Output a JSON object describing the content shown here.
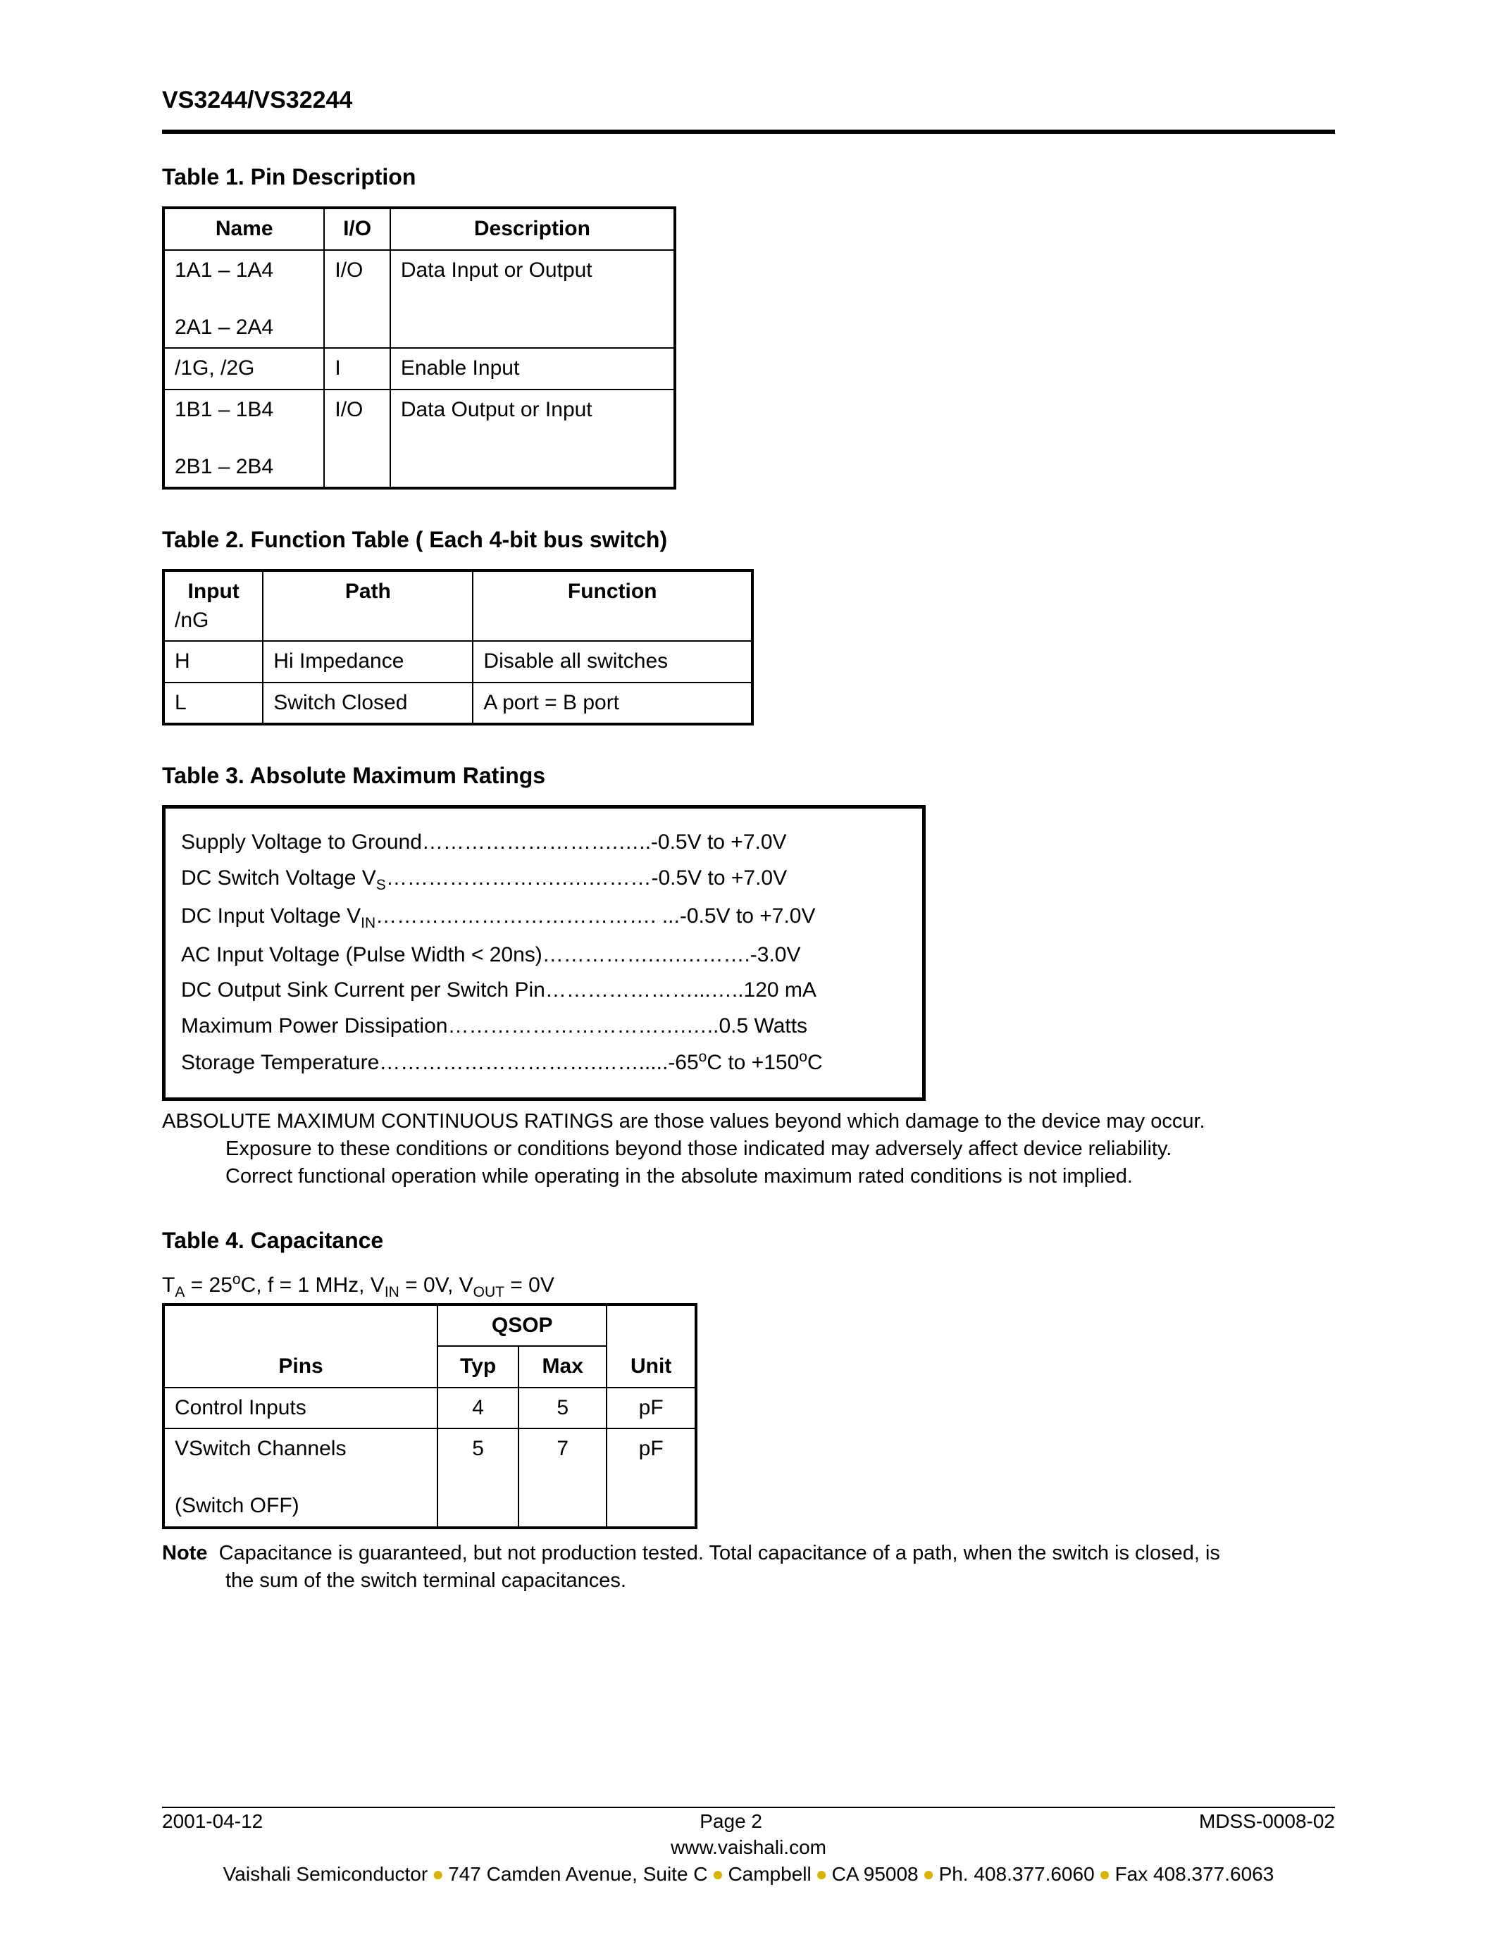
{
  "header": {
    "title": "VS3244/VS32244"
  },
  "table1": {
    "title": "Table 1.  Pin Description",
    "headers": [
      "Name",
      "I/O",
      "Description"
    ],
    "rows": [
      {
        "name_l1": "1A1 – 1A4",
        "name_l2": "2A1 – 2A4",
        "io": "I/O",
        "desc": "Data Input or Output"
      },
      {
        "name_l1": "/1G, /2G",
        "name_l2": "",
        "io": "I",
        "desc": "Enable Input"
      },
      {
        "name_l1": "1B1 – 1B4",
        "name_l2": "2B1 – 2B4",
        "io": "I/O",
        "desc": "Data Output or Input"
      }
    ]
  },
  "table2": {
    "title": "Table 2.  Function Table ( Each 4-bit bus switch)",
    "headers": {
      "input": "Input",
      "input_sub": "/nG",
      "path": "Path",
      "func": "Function"
    },
    "rows": [
      {
        "input": "H",
        "path": "Hi Impedance",
        "func": "Disable all switches"
      },
      {
        "input": "L",
        "path": "Switch Closed",
        "func": "A port = B port"
      }
    ]
  },
  "table3": {
    "title": "Table 3.  Absolute Maximum Ratings",
    "lines": {
      "supply_label": "Supply Voltage to Ground……………………….…..-0.5V to +7.0V",
      "dcswitch_pre": "DC Switch Voltage V",
      "dcswitch_sub": "S",
      "dcswitch_post": "…………………….….………-0.5V to +7.0V",
      "dcin_pre": "DC Input Voltage V",
      "dcin_sub": "IN",
      "dcin_post": "…………………………………. ...-0.5V to +7.0V",
      "ac": "AC Input Voltage (Pulse Width < 20ns)…………….….……….-3.0V",
      "sink": "DC Output Sink Current per Switch Pin…………………...…..120 mA",
      "power": "Maximum Power Dissipation…………………………….…..0.5 Watts",
      "storage_pre": "Storage Temperature………………………….…….....-65",
      "storage_sup1": "o",
      "storage_mid": "C to +150",
      "storage_sup2": "o",
      "storage_post": "C"
    },
    "note1": "ABSOLUTE MAXIMUM CONTINUOUS RATINGS are those values beyond which damage to the device may occur.",
    "note2": "Exposure to these conditions or conditions beyond those indicated may adversely affect device reliability.",
    "note3": "Correct functional operation while operating in the absolute maximum rated conditions is not implied."
  },
  "table4": {
    "title": "Table 4.  Capacitance",
    "cond": {
      "pre": "T",
      "s1": "A",
      "t1": " = 25",
      "sup1": "o",
      "t2": "C, f = 1 MHz, V",
      "s2": "IN",
      "t3": " = 0V, V",
      "s3": "OUT",
      "t4": " = 0V"
    },
    "headers": {
      "pins": "Pins",
      "pkg": "QSOP",
      "typ": "Typ",
      "max": "Max",
      "unit": "Unit"
    },
    "rows": [
      {
        "pins_l1": "Control Inputs",
        "pins_l2": "",
        "typ": "4",
        "max": "5",
        "unit": "pF"
      },
      {
        "pins_l1": "VSwitch Channels",
        "pins_l2": "(Switch OFF)",
        "typ": "5",
        "max": "7",
        "unit": "pF"
      }
    ],
    "note_label": "Note",
    "note_text1": "Capacitance is guaranteed, but not production tested. Total capacitance of a path, when the switch is closed, is",
    "note_text2": "the sum of the switch terminal capacitances."
  },
  "footer": {
    "date": "2001-04-12",
    "page": "Page 2",
    "doc": "MDSS-0008-02",
    "url": "www.vaishali.com",
    "addr": {
      "a": "Vaishali Semiconductor",
      "b": "747 Camden Avenue, Suite C",
      "c": "Campbell",
      "d": "CA 95008",
      "e": "Ph. 408.377.6060",
      "f": "Fax 408.377.6063"
    },
    "bullet": "●"
  }
}
